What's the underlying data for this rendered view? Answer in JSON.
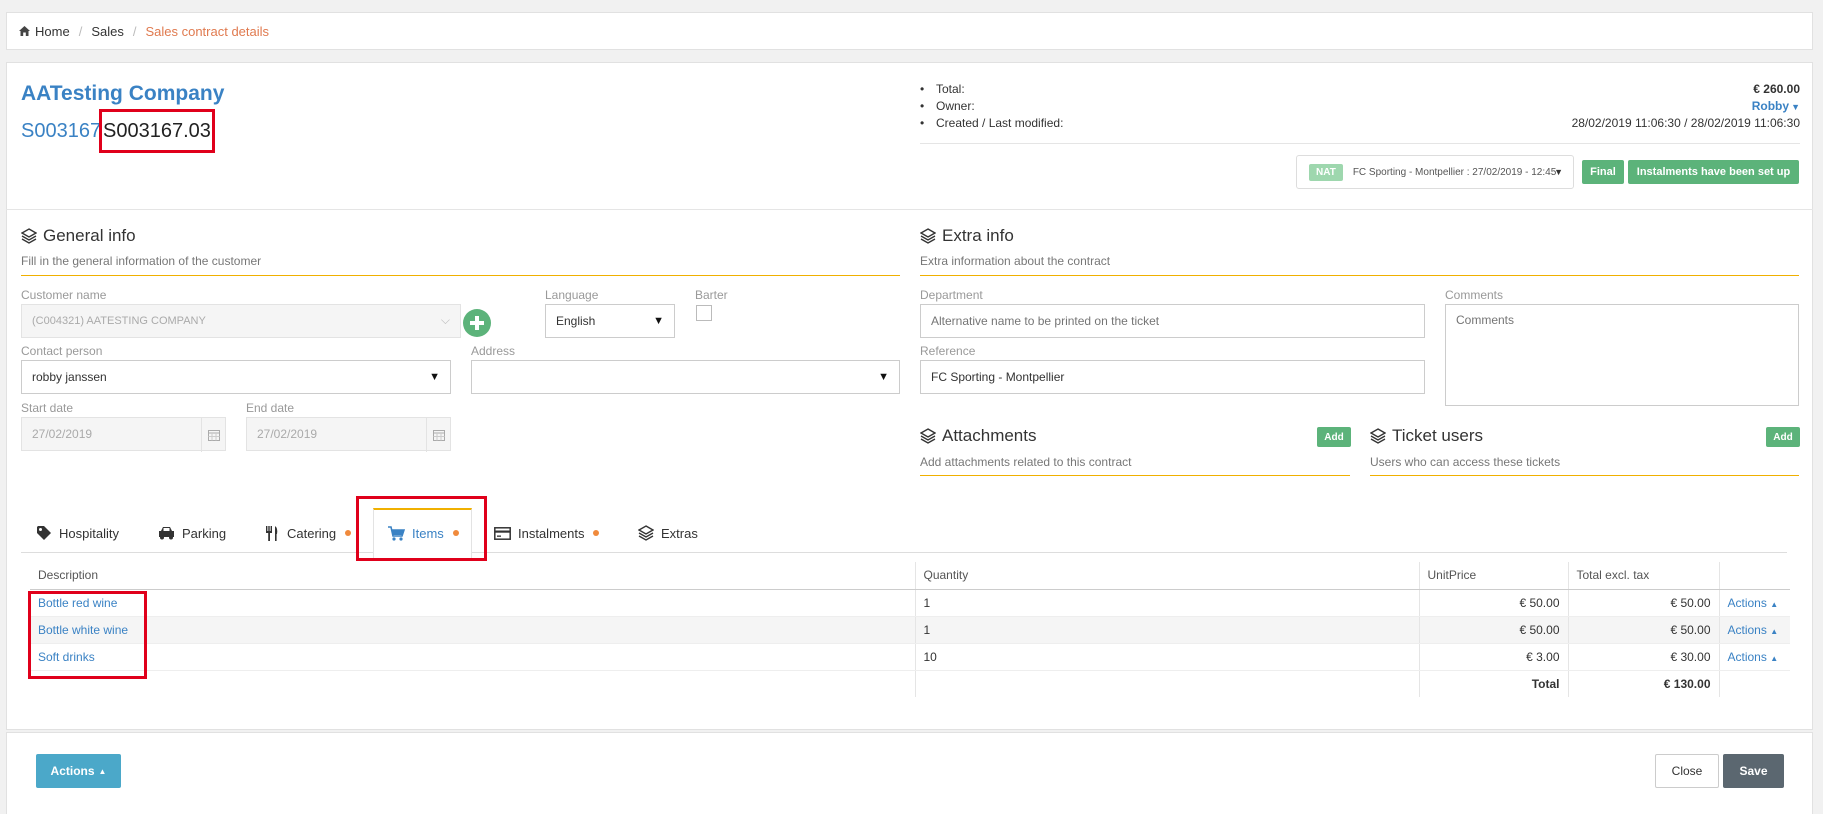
{
  "breadcrumb": {
    "home": "Home",
    "sales": "Sales",
    "current": "Sales contract details"
  },
  "header": {
    "company": "AATesting Company",
    "contract_code": "S003167",
    "contract_version": "S003167.03"
  },
  "summary": {
    "total_label": "Total:",
    "total_value": "€ 260.00",
    "owner_label": "Owner:",
    "owner_value": "Robby",
    "created_label": "Created / Last modified:",
    "created_value": "28/02/2019 11:06:30 / 28/02/2019 11:06:30"
  },
  "status": {
    "event_badge": "NAT",
    "event_text": "FC Sporting - Montpellier : 27/02/2019 - 12:45",
    "final_label": "Final",
    "instalments_label": "Instalments have been set up"
  },
  "general_info": {
    "title": "General info",
    "subtitle": "Fill in the general information of the customer",
    "customer_label": "Customer name",
    "customer_value": "(C004321) AATESTING COMPANY",
    "language_label": "Language",
    "language_value": "English",
    "barter_label": "Barter",
    "contact_label": "Contact person",
    "contact_value": "robby janssen",
    "address_label": "Address",
    "address_value": "",
    "start_label": "Start date",
    "start_value": "27/02/2019",
    "end_label": "End date",
    "end_value": "27/02/2019"
  },
  "extra_info": {
    "title": "Extra info",
    "subtitle": "Extra information about the contract",
    "department_label": "Department",
    "department_placeholder": "Alternative name to be printed on the ticket",
    "comments_label": "Comments",
    "comments_placeholder": "Comments",
    "reference_label": "Reference",
    "reference_value": "FC Sporting - Montpellier"
  },
  "attachments": {
    "title": "Attachments",
    "subtitle": "Add attachments related to this contract",
    "add_label": "Add"
  },
  "ticket_users": {
    "title": "Ticket users",
    "subtitle": "Users who can access these tickets",
    "add_label": "Add"
  },
  "tabs": {
    "hospitality": "Hospitality",
    "parking": "Parking",
    "catering": "Catering",
    "items": "Items",
    "instalments": "Instalments",
    "extras": "Extras"
  },
  "table": {
    "headers": {
      "description": "Description",
      "quantity": "Quantity",
      "unit_price": "UnitPrice",
      "total": "Total excl. tax"
    },
    "rows": [
      {
        "description": "Bottle red wine",
        "quantity": "1",
        "unit_price": "€ 50.00",
        "total": "€ 50.00",
        "actions": "Actions"
      },
      {
        "description": "Bottle white wine",
        "quantity": "1",
        "unit_price": "€ 50.00",
        "total": "€ 50.00",
        "actions": "Actions"
      },
      {
        "description": "Soft drinks",
        "quantity": "10",
        "unit_price": "€ 3.00",
        "total": "€ 30.00",
        "actions": "Actions"
      }
    ],
    "total_label": "Total",
    "total_value": "€ 130.00"
  },
  "footer": {
    "actions_label": "Actions",
    "close_label": "Close",
    "save_label": "Save"
  },
  "colors": {
    "accent_blue": "#3a82c4",
    "breadcrumb_active": "#e07a4f",
    "green": "#5cb37a",
    "highlight_red": "#e0001b",
    "underline_orange": "#f0b000"
  }
}
